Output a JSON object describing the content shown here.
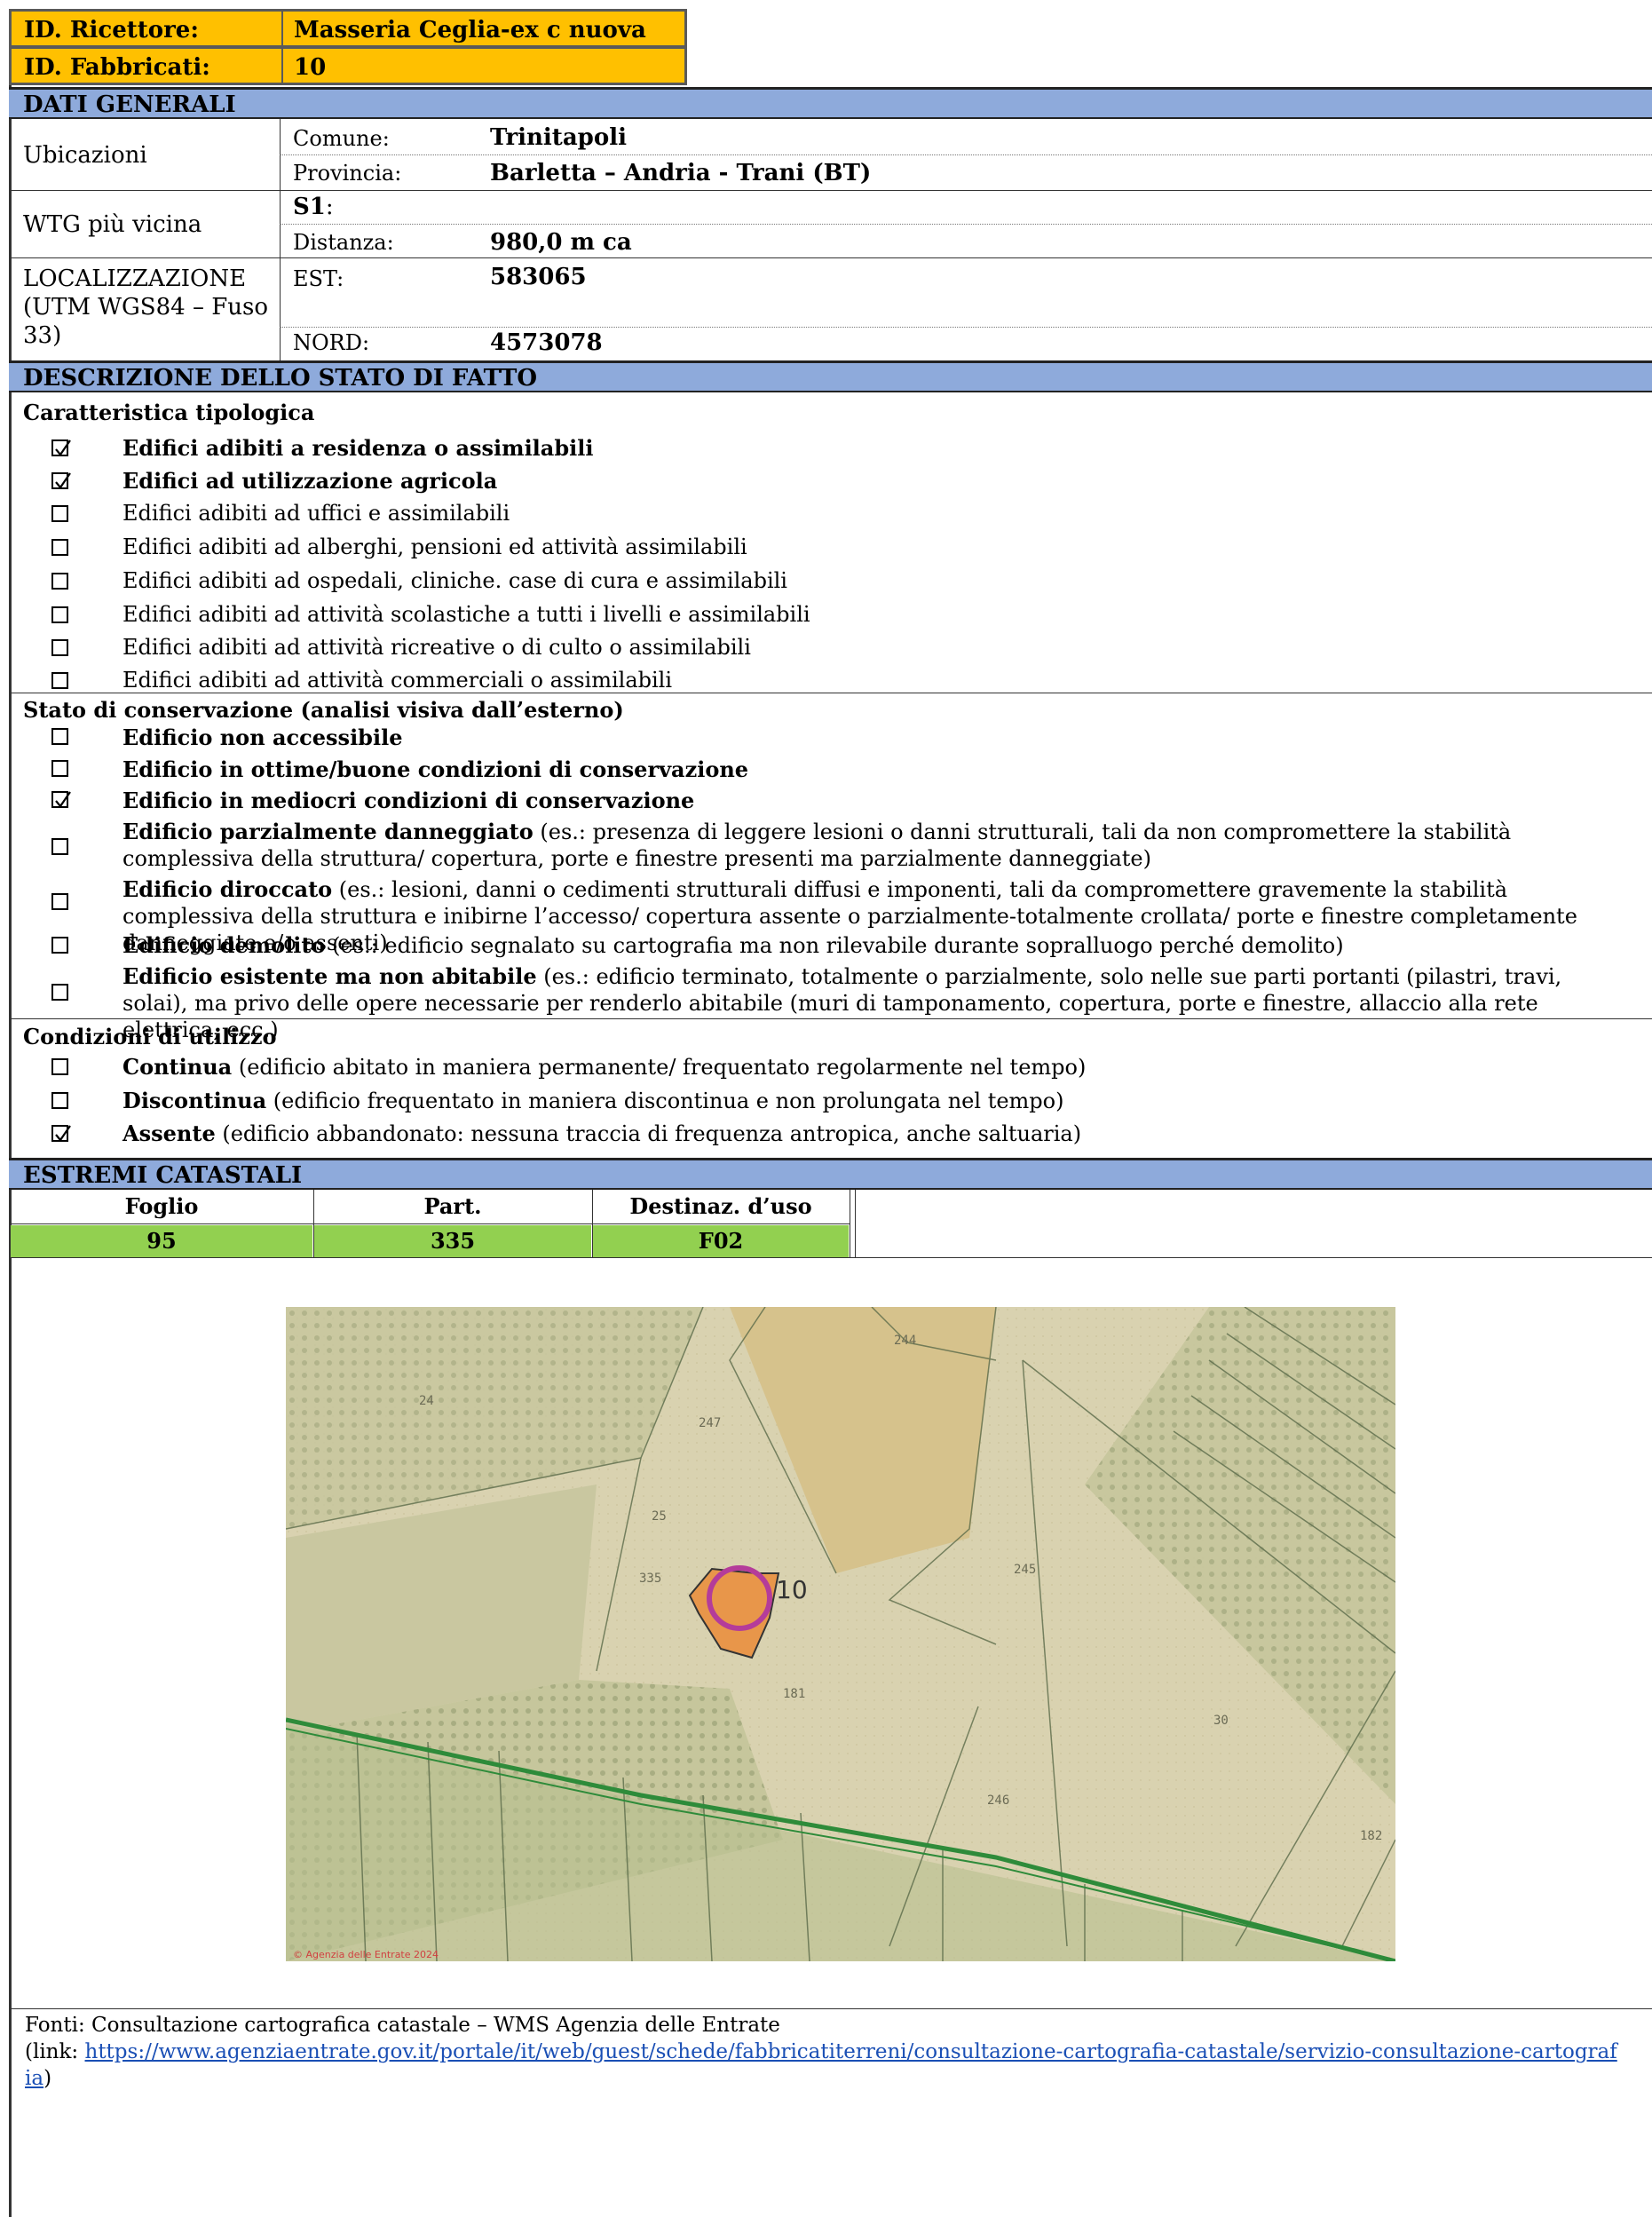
{
  "header": {
    "ricettore_label": "ID. Ricettore:",
    "ricettore_value": "Masseria Ceglia-ex c nuova",
    "fabbricati_label": "ID. Fabbricati:",
    "fabbricati_value": "10",
    "color": "#ffc000"
  },
  "dati_generali": {
    "title": "DATI GENERALI",
    "ubicazioni": "Ubicazioni",
    "comune_label": "Comune:",
    "comune_value": "Trinitapoli",
    "provincia_label": "Provincia:",
    "provincia_value": "Barletta – Andria - Trani (BT)",
    "wtg_label": "WTG più vicina",
    "wtg_value": "S1",
    "wtg_colon": ":",
    "distanza_label": "Distanza:",
    "distanza_value": "980,0 m ca",
    "localizzazione_label": "LOCALIZZAZIONE (UTM WGS84 – Fuso 33)",
    "est_label": "EST:",
    "est_value": "583065",
    "nord_label": "NORD:",
    "nord_value": "4573078"
  },
  "descrizione": {
    "title": "DESCRIZIONE DELLO STATO DI FATTO",
    "tipologica_title": "Caratteristica tipologica",
    "tipologica": [
      {
        "label": "Edifici adibiti a residenza o assimilabili",
        "checked": true
      },
      {
        "label": "Edifici ad utilizzazione agricola",
        "checked": true
      },
      {
        "label": "Edifici adibiti ad uffici e assimilabili",
        "checked": false
      },
      {
        "label": "Edifici adibiti ad alberghi, pensioni ed attività assimilabili",
        "checked": false
      },
      {
        "label": "Edifici adibiti ad ospedali, cliniche. case di cura e assimilabili",
        "checked": false
      },
      {
        "label": "Edifici adibiti ad attività scolastiche a tutti i livelli e assimilabili",
        "checked": false
      },
      {
        "label": "Edifici adibiti ad attività ricreative o di culto o assimilabili",
        "checked": false
      },
      {
        "label": "Edifici adibiti ad attività commerciali o assimilabili",
        "checked": false
      }
    ],
    "conservazione_title": "Stato di conservazione (analisi visiva dall’esterno)",
    "conservazione": [
      {
        "bold": "Edificio non accessibile",
        "rest": "",
        "checked": false
      },
      {
        "bold": "Edificio in ottime/buone condizioni di conservazione",
        "rest": "",
        "checked": false
      },
      {
        "bold": "Edificio in mediocri condizioni di conservazione",
        "rest": "",
        "checked": true
      },
      {
        "bold": "Edificio parzialmente danneggiato",
        "rest": " (es.: presenza di leggere lesioni o danni strutturali, tali da non compromettere la stabilità complessiva della struttura/ copertura, porte e finestre presenti ma parzialmente danneggiate)",
        "checked": false
      },
      {
        "bold": "Edificio diroccato",
        "rest": " (es.: lesioni, danni o cedimenti strutturali diffusi e imponenti, tali da compromettere gravemente la stabilità complessiva della struttura e inibirne l’accesso/ copertura assente o parzialmente-totalmente crollata/ porte e finestre completamente danneggiate e/o assenti)",
        "checked": false
      },
      {
        "bold": "Edificio demolito",
        "rest": " (es.: edificio segnalato su cartografia ma non rilevabile durante sopralluogo perché demolito)",
        "checked": false
      },
      {
        "bold": "Edificio esistente ma non abitabile",
        "rest": " (es.: edificio terminato, totalmente o parzialmente, solo nelle sue parti portanti (pilastri, travi, solai), ma privo delle opere necessarie per renderlo abitabile (muri di tamponamento, copertura, porte e finestre, allaccio alla rete elettrica, ecc.)",
        "checked": false
      }
    ],
    "utilizzo_title": "Condizioni di utilizzo",
    "utilizzo": [
      {
        "bold": "Continua",
        "rest": " (edificio abitato in maniera permanente/ frequentato regolarmente nel tempo)",
        "checked": false
      },
      {
        "bold": "Discontinua",
        "rest": " (edificio frequentato in maniera discontinua e non prolungata nel tempo)",
        "checked": false
      },
      {
        "bold": "Assente",
        "rest": " (edificio abbandonato: nessuna traccia di frequenza antropica, anche saltuaria)",
        "checked": true
      }
    ]
  },
  "catastali": {
    "title": "ESTREMI CATASTALI",
    "headers": [
      "Foglio",
      "Part.",
      "Destinaz. d’uso"
    ],
    "values": [
      "95",
      "335",
      "F02"
    ],
    "value_color": "#92d050",
    "section_color": "#8eaadb"
  },
  "map": {
    "parcel_labels": [
      "24",
      "247",
      "244",
      "25",
      "335",
      "245",
      "181",
      "30",
      "246",
      "182"
    ],
    "building_label": "10",
    "copyright": "© Agenzia delle Entrate 2024"
  },
  "fonti": {
    "line1": "Fonti: Consultazione cartografica catastale – WMS Agenzia delle Entrate",
    "link_prefix": "(link: ",
    "link_text": "https://www.agenziaentrate.gov.it/portale/it/web/guest/schede/fabbricatiterreni/consultazione-cartografia-catastale/servizio-consultazione-cartografia",
    "link_suffix": ")"
  }
}
